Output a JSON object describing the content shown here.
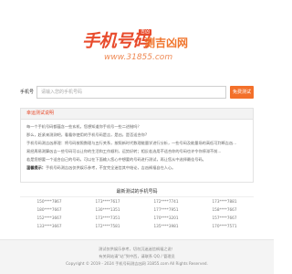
{
  "logo": {
    "main": "手机号码",
    "badge": "吉凶",
    "side": "测吉凶网",
    "url": "www.31855.com"
  },
  "search": {
    "label": "手机号",
    "placeholder": "请输入您的手机号码",
    "button": "免费测试"
  },
  "notice": {
    "title": "幸运测试说明",
    "paragraphs": [
      "每一个手机号码都蕴含一些玄机，您想知道你手机号一些二进制吗？",
      "那么，赶紧来测测吧，看看你使用的手机号码是吉，是凶，是否适合你?",
      "手机号码测吉凶原理：将号码按照数理与五行关系，按照新时代数理能量学进行分析，一些号码及能量场的高低可判断吉凶...",
      "易经周易测算凶吉一些号码可以让你的生活和工作顺利，运势好转；相反若选用不适合你的号码也许令你停滞不前...",
      "若是您想要一个适合自己的号码，可以在下面输入您心中想要的号码进行测试，再让您从中选择最佳号码。"
    ],
    "tip_label": "温馨提示：",
    "tip": "手机号码测吉凶仅供娱乐参考，不宜完全迷信其中结论，吉凶祸福自在人心。"
  },
  "recent": {
    "title": "最新测试的手机号码",
    "rows": [
      [
        "150****7867",
        "173****7617",
        "172****7741",
        "173****7881"
      ],
      [
        "180****7667",
        "130****1351",
        "177****7951",
        "158****7667"
      ],
      [
        "152****3667",
        "173****7351",
        "170****3201",
        "157****7667"
      ],
      [
        "133****3667",
        "172****7581",
        "135****3981",
        "170****7571"
      ]
    ]
  },
  "footer": {
    "line1": "测试仅供娱乐参考，切勿沉迷迷信祸福之说！",
    "line2": "有关网站请“站”到中西，请联系 QQ / 管理员",
    "line3": "Copyright © 2019 - 2024 手机号码测吉凶网 31855.com All Rights Reserved."
  }
}
